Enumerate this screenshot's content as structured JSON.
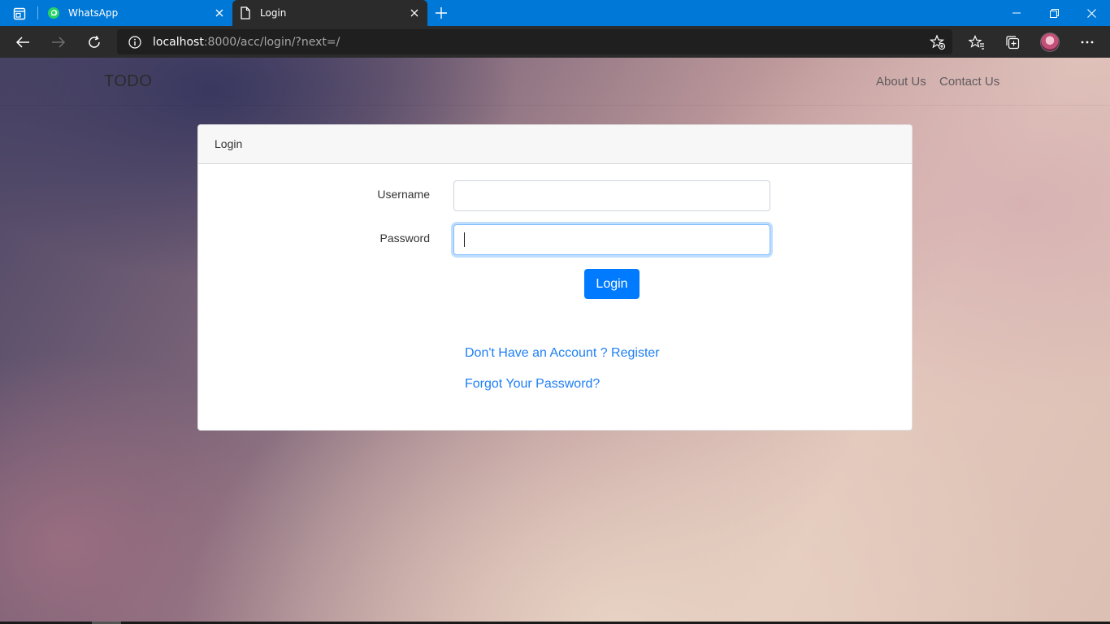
{
  "browser": {
    "tabs": [
      {
        "title": "WhatsApp",
        "icon": "whatsapp-icon",
        "active": false
      },
      {
        "title": "Login",
        "icon": "page-icon",
        "active": true
      }
    ],
    "address": {
      "host": "localhost",
      "rest": ":8000/acc/login/?next=/"
    }
  },
  "navbar": {
    "brand": "TODO",
    "links": [
      "About Us",
      "Contact Us"
    ]
  },
  "login_card": {
    "header": "Login",
    "username_label": "Username",
    "username_value": "",
    "password_label": "Password",
    "password_value": "",
    "submit_label": "Login",
    "register_link": "Don't Have an Account ? Register",
    "forgot_link": "Forgot Your Password?"
  },
  "colors": {
    "browser_accent": "#0078d7",
    "primary": "#007bff",
    "link": "#1e7ff5"
  }
}
